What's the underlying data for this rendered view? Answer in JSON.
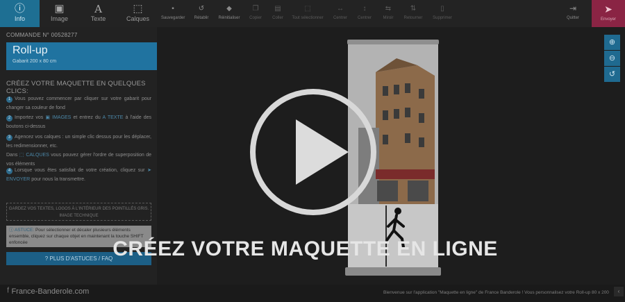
{
  "tabs": [
    {
      "label": "Info",
      "icon": "info-icon",
      "active": true
    },
    {
      "label": "Image",
      "icon": "image-icon"
    },
    {
      "label": "Texte",
      "icon": "text-icon"
    },
    {
      "label": "Calques",
      "icon": "layers-icon"
    }
  ],
  "tools": [
    {
      "label": "Sauvegarder",
      "icon": "save-icon"
    },
    {
      "label": "Rétablir",
      "icon": "undo-icon"
    },
    {
      "label": "Réinitialiser",
      "icon": "eraser-icon"
    },
    {
      "label": "Copier",
      "icon": "copy-icon"
    },
    {
      "label": "Coller",
      "icon": "paste-icon"
    },
    {
      "label": "Tout sélectionner",
      "icon": "select-all-icon"
    },
    {
      "label": "Centrer",
      "icon": "center-horizontal-icon"
    },
    {
      "label": "Centrer",
      "icon": "center-vertical-icon"
    },
    {
      "label": "Miroir",
      "icon": "mirror-icon"
    },
    {
      "label": "Retourner",
      "icon": "flip-icon"
    },
    {
      "label": "Supprimer",
      "icon": "trash-icon"
    }
  ],
  "quit_label": "Quitter",
  "send_label": "Envoyer",
  "order_number": "COMMANDE N° 00528277",
  "product": {
    "name": "Roll-up",
    "size": "Gabarit 200 x 80 cm"
  },
  "howto_title": "CRÉEZ VOTRE MAQUETTE EN QUELQUES CLICS:",
  "steps": {
    "s1": {
      "num": "1",
      "text": "Vous pouvez commencer par cliquer sur votre gabarit pour changer sa couleur de fond"
    },
    "s2": {
      "num": "2",
      "a": "Importez vos",
      "images": "IMAGES",
      "b": "et entrez du",
      "texte": "TEXTE",
      "c": "à l'aide des boutons ci-dessus"
    },
    "s3": {
      "num": "3",
      "a": "Agencez vos calques : un simple clic dessus pour les déplacer, les redimensionner, etc.",
      "b": "Dans",
      "calques": "CALQUES",
      "c": "vous pouvez gérer l'ordre de superposition de vos éléments"
    },
    "s4": {
      "num": "4",
      "a": "Lorsque vous êtes satisfait de votre création, cliquez sur",
      "envoyer": "ENVOYER",
      "b": "pour nous la transmettre."
    }
  },
  "keep_note": "GARDEZ VOS TEXTES, LOGOS À L'INTÉRIEUR DES POINTILLÉS GRIS. IMAGE TECHNIQUE",
  "tip": {
    "key": "ASTUCE:",
    "text": "Pour sélectionner et décaler plusieurs éléments ensemble, cliquez sur chaque objet en maintenant la touche SHIFT enfoncée"
  },
  "faq_label": "PLUS D'ASTUCES / FAQ",
  "headline": "CRÉEZ VOTRE MAQUETTE EN LIGNE",
  "logo_text": "France-Banderole.com",
  "ticker": "Bienvenue sur l'application \"Maquette en ligne\" de France Banderole ! Vous personnalisez votre Roll-up 80 x 200",
  "colors": {
    "accent": "#1e6f93",
    "send": "#8a2444",
    "background": "#1d1d1d"
  }
}
